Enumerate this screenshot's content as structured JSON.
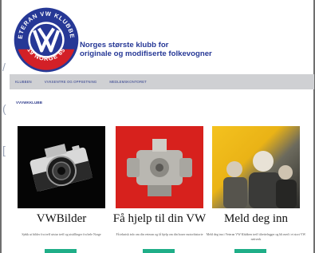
{
  "site": {
    "logo": {
      "ring_top_text": "VETERAN VW KLUBBEN",
      "ring_bottom_text": "19 NORGE 65",
      "colors": {
        "ring": "#263896",
        "ring_text": "#ffffff",
        "bottom_band": "#d32027"
      }
    },
    "tagline_line1": "Norges største klubb for",
    "tagline_line2": "originale og modifiserte folkevogner"
  },
  "nav": {
    "items": [
      {
        "label": "KLUBBEN"
      },
      {
        "label": "VVKSENTRE OG OPPSETNING"
      },
      {
        "label": "MEDLEMSKONTORET"
      }
    ]
  },
  "breadcrumb": "VVVWKKLUBB",
  "cards": [
    {
      "title": "VWBilder",
      "description": "Sjekk ut bilder fra treff utstur treff og utstillinger fra hele Norge",
      "image": "camera-photo"
    },
    {
      "title": "Få hjelp til din VW",
      "description": "Få teknisk info om din veteran og få hjelp om din boxer motorhistorie",
      "image": "engine-photo"
    },
    {
      "title": "Meld deg inn",
      "description": "Meld deg inn i Veteran VW Klubben treff tilrettelegger og bli med i et stort VW nettverk",
      "image": "people-photo"
    }
  ],
  "colors": {
    "accent_button": "#1fae88",
    "navbar_bg": "#cfd0d3",
    "brand_blue": "#263896"
  }
}
